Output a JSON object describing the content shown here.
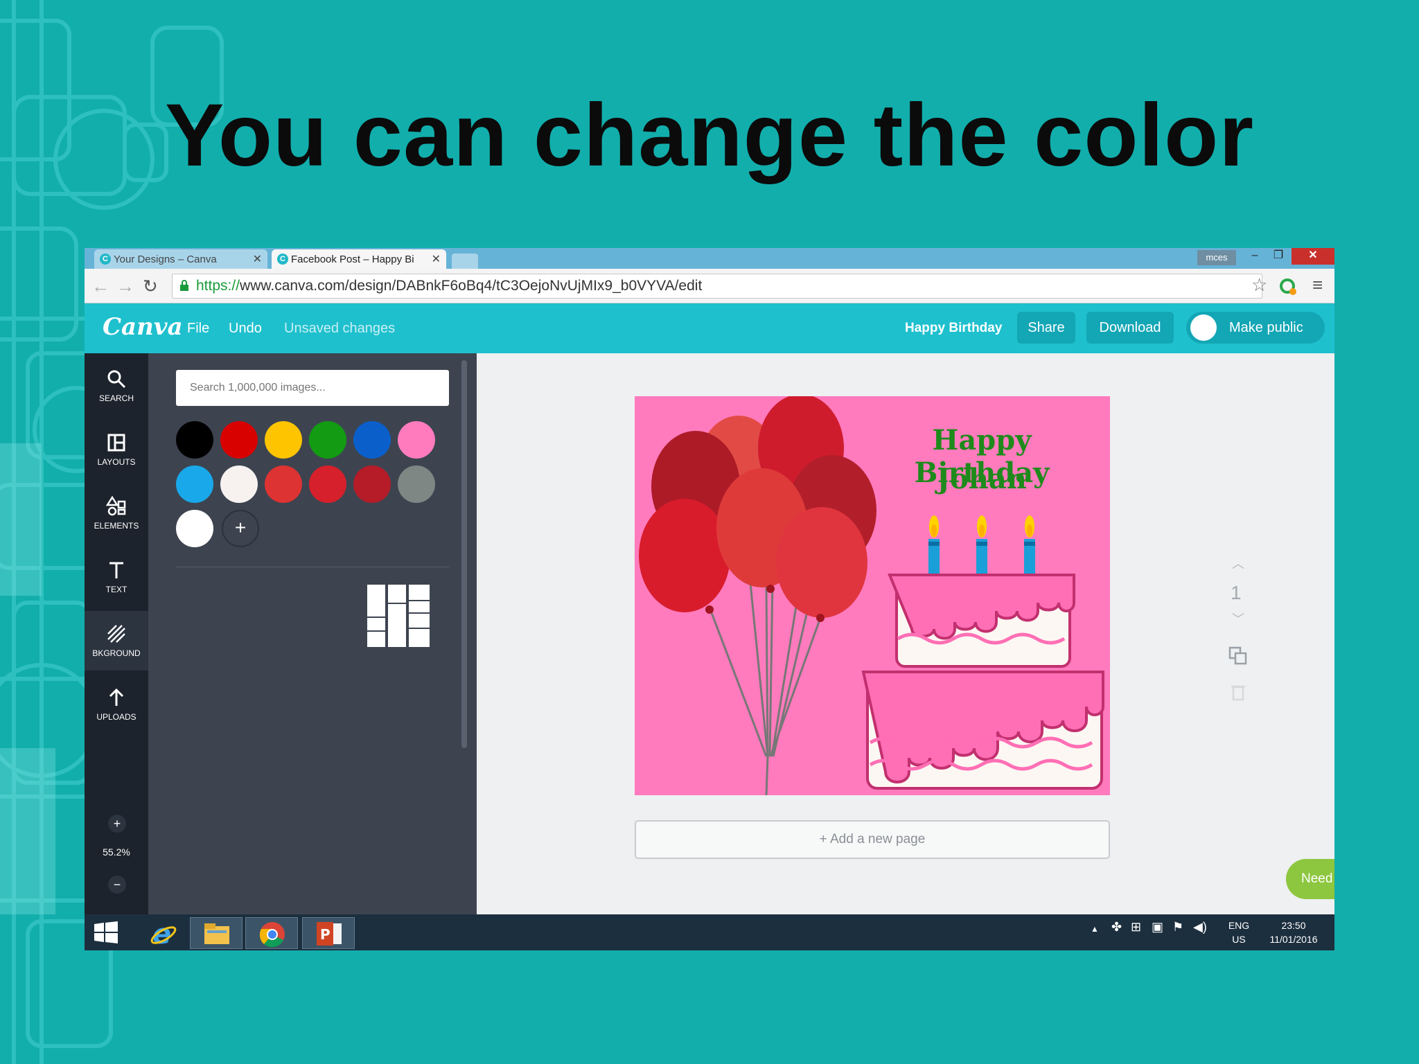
{
  "slide": {
    "title": "You can change the color"
  },
  "browser": {
    "tabs": [
      {
        "label": "Your Designs – Canva",
        "favicon": "C"
      },
      {
        "label": "Facebook Post – Happy Bi",
        "favicon": "C"
      }
    ],
    "profile_name": "mces",
    "url_secure": "https://",
    "url_rest": "www.canva.com/design/DABnkF6oBq4/tC3OejoNvUjMIx9_b0VYVA/edit"
  },
  "canva": {
    "logo": "Canva",
    "menu": {
      "file": "File",
      "undo": "Undo",
      "status": "Unsaved changes"
    },
    "design_name": "Happy Birthday",
    "share_label": "Share",
    "download_label": "Download",
    "make_public_label": "Make public"
  },
  "sidebar": {
    "items": [
      {
        "label": "SEARCH",
        "icon": "search-icon"
      },
      {
        "label": "LAYOUTS",
        "icon": "layouts-icon"
      },
      {
        "label": "ELEMENTS",
        "icon": "elements-icon"
      },
      {
        "label": "TEXT",
        "icon": "text-icon"
      },
      {
        "label": "BKGROUND",
        "icon": "background-icon"
      },
      {
        "label": "UPLOADS",
        "icon": "uploads-icon"
      }
    ],
    "zoom_in": "+",
    "zoom_level": "55.2%",
    "zoom_out": "−"
  },
  "panel": {
    "search_placeholder": "Search 1,000,000 images...",
    "swatches": [
      "#000000",
      "#d90000",
      "#ffc400",
      "#139b13",
      "#0b5fcb",
      "#ff7bbd",
      "#19a8ea",
      "#f7f2f0",
      "#de3333",
      "#d6202c",
      "#b51c28",
      "#7e8784",
      "#ffffff"
    ],
    "add_color": "+"
  },
  "canvas": {
    "line1": "Happy Birthday",
    "line2": "Johan",
    "add_page": "+ Add a new page",
    "page_number": "1"
  },
  "help": {
    "label": "Need help",
    "icon": "?"
  },
  "taskbar": {
    "language": "ENG",
    "region": "US",
    "time": "23:50",
    "date": "11/01/2016"
  },
  "colors": {
    "slide_bg": "#12aeac",
    "canva_header": "#1fc0ce",
    "card_bg": "#ff7bbd",
    "help_green": "#8dc63f"
  }
}
